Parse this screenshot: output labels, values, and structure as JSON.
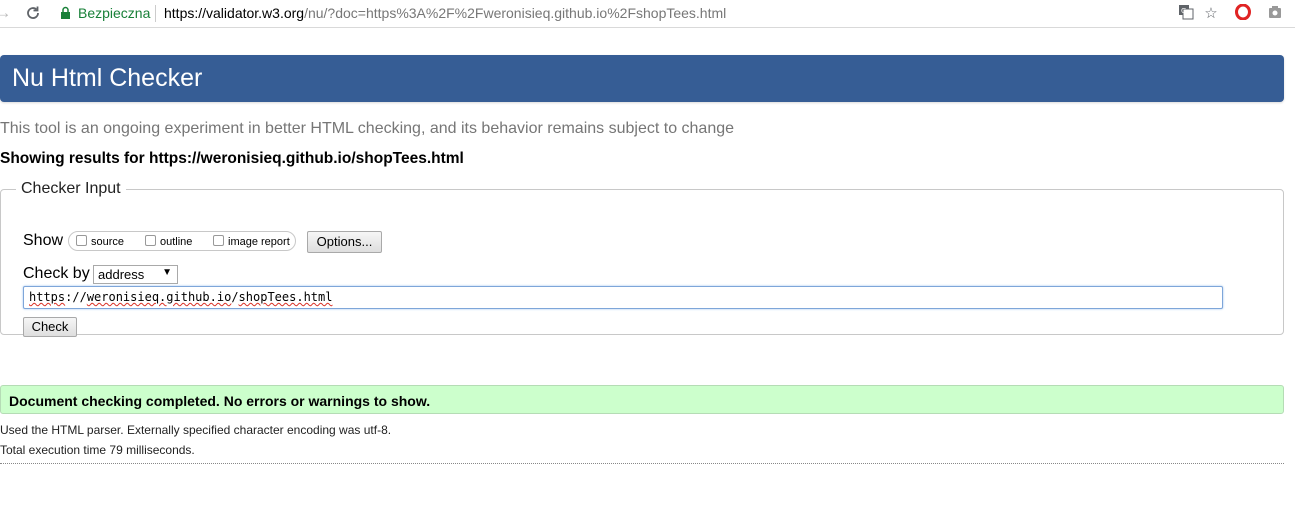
{
  "browser": {
    "secure_label": "Bezpieczna",
    "url_host": "https://validator.w3.org",
    "url_rest": "/nu/?doc=https%3A%2F%2Fweronisieq.github.io%2FshopTees.html",
    "icons": [
      "back-icon",
      "reload-icon",
      "lock-icon",
      "translate-icon",
      "star-icon",
      "opera-icon",
      "camera-icon"
    ]
  },
  "header": {
    "title": "Nu Html Checker"
  },
  "subtitle": "This tool is an ongoing experiment in better HTML checking, and its behavior remains subject to change",
  "results_heading": "Showing results for https://weronisieq.github.io/shopTees.html",
  "checker": {
    "legend": "Checker Input",
    "show_label": "Show",
    "show_options": [
      {
        "label": "source",
        "checked": false
      },
      {
        "label": "outline",
        "checked": false
      },
      {
        "label": "image report",
        "checked": false
      }
    ],
    "options_button": "Options...",
    "checkby_label": "Check by",
    "checkby_value": "address",
    "url_input": {
      "scheme": "https",
      "sep1": "://",
      "host": "weronisieq.github.io",
      "sep2": "/",
      "path": "shopTees.html"
    },
    "check_button": "Check"
  },
  "status": {
    "message": "Document checking completed. No errors or warnings to show.",
    "color": "#ccffcc"
  },
  "details": [
    "Used the HTML parser. Externally specified character encoding was utf-8.",
    "Total execution time 79 milliseconds."
  ],
  "colors": {
    "banner": "#365d95",
    "secure": "#188038"
  }
}
